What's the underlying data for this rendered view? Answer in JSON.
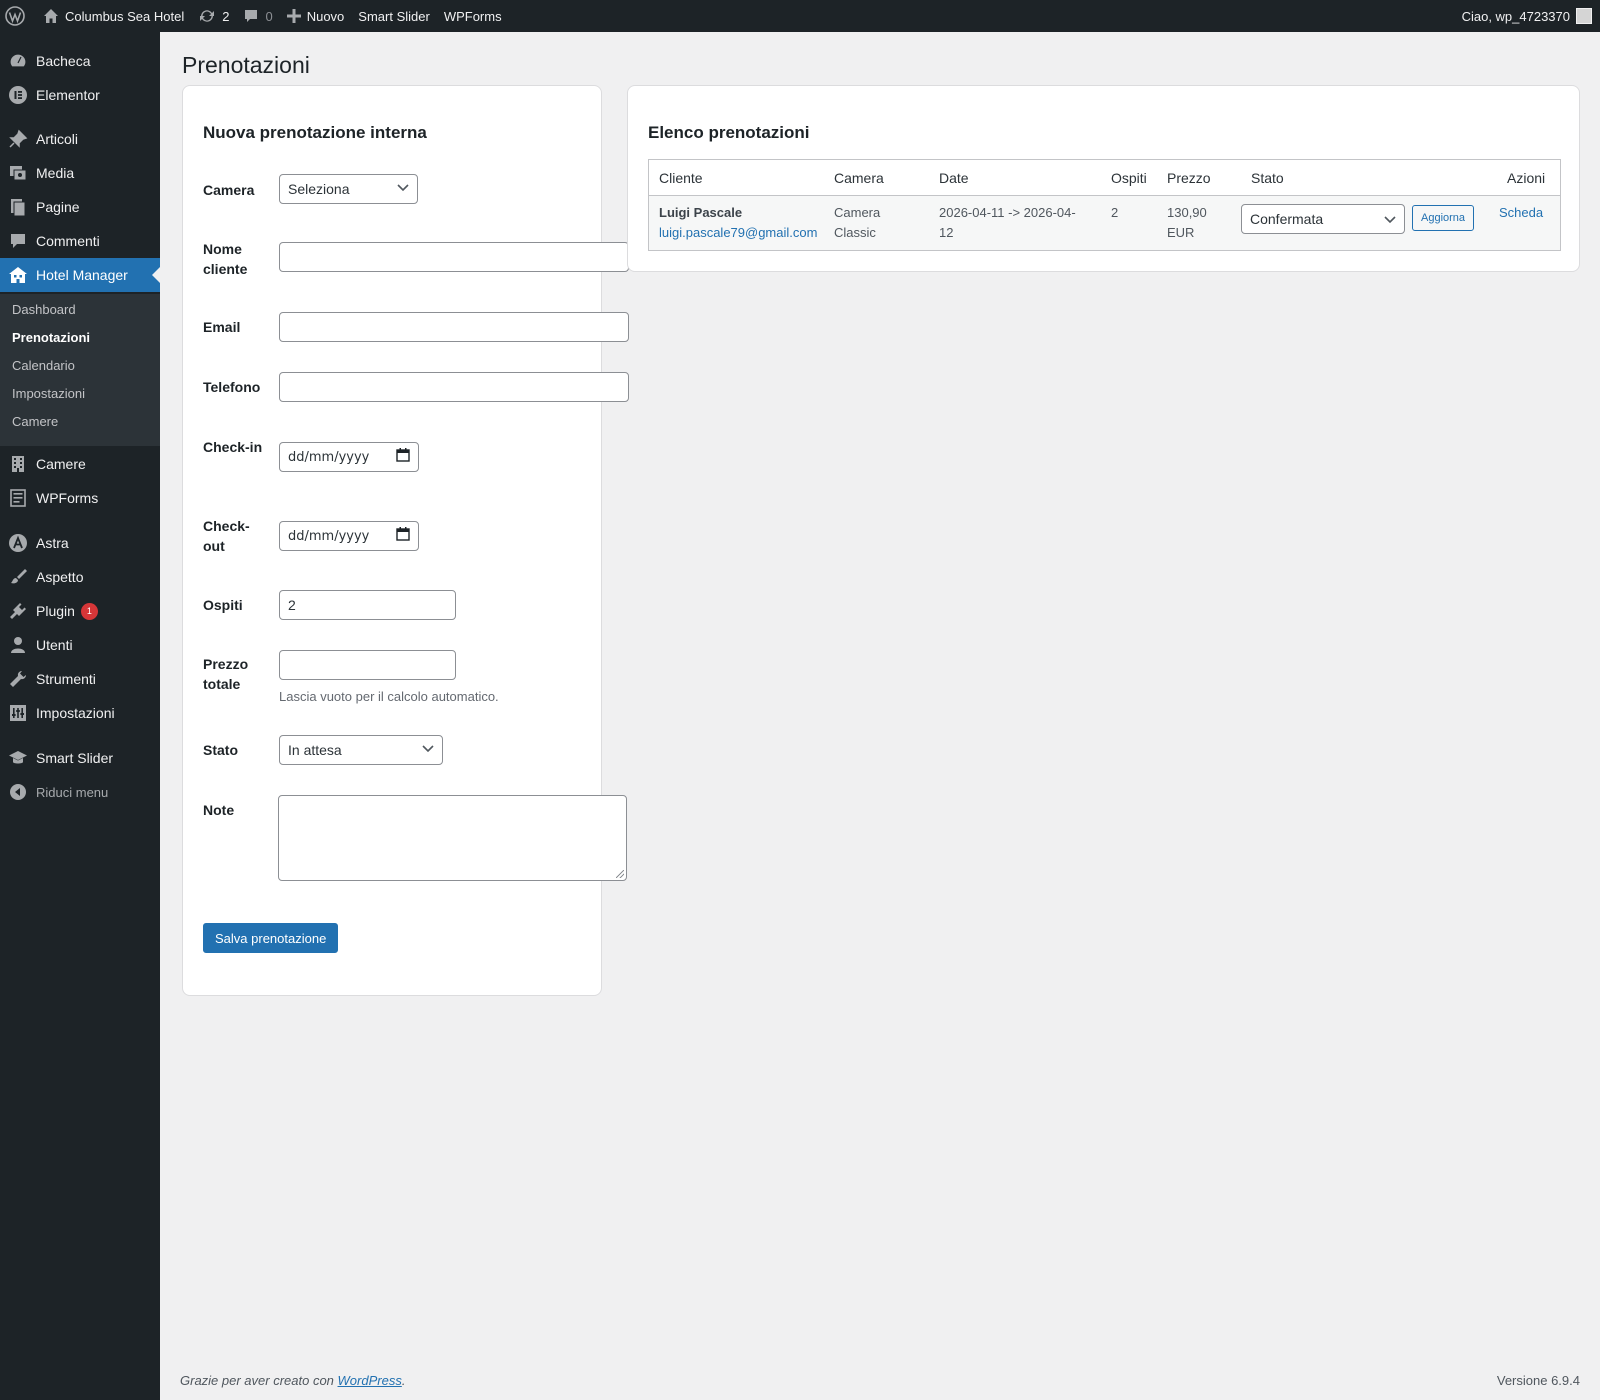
{
  "adminbar": {
    "site_name": "Columbus Sea Hotel",
    "updates_count": "2",
    "comments_count": "0",
    "new_label": "Nuovo",
    "smart_slider": "Smart Slider",
    "wpforms": "WPForms",
    "greeting": "Ciao, wp_4723370"
  },
  "sidebar": {
    "items": [
      {
        "label": "Bacheca",
        "icon": "dashboard-icon"
      },
      {
        "label": "Elementor",
        "icon": "elementor-icon"
      },
      {
        "label": "Articoli",
        "icon": "pin-icon"
      },
      {
        "label": "Media",
        "icon": "media-icon"
      },
      {
        "label": "Pagine",
        "icon": "pages-icon"
      },
      {
        "label": "Commenti",
        "icon": "comment-icon"
      },
      {
        "label": "Hotel Manager",
        "icon": "building-icon"
      },
      {
        "label": "Camere",
        "icon": "building-icon"
      },
      {
        "label": "WPForms",
        "icon": "form-icon"
      },
      {
        "label": "Astra",
        "icon": "astra-icon"
      },
      {
        "label": "Aspetto",
        "icon": "brush-icon"
      },
      {
        "label": "Plugin",
        "icon": "plugin-icon",
        "badge": "1"
      },
      {
        "label": "Utenti",
        "icon": "user-icon"
      },
      {
        "label": "Strumenti",
        "icon": "wrench-icon"
      },
      {
        "label": "Impostazioni",
        "icon": "settings-icon"
      },
      {
        "label": "Smart Slider",
        "icon": "graduation-icon"
      }
    ],
    "submenu": [
      "Dashboard",
      "Prenotazioni",
      "Calendario",
      "Impostazioni",
      "Camere"
    ],
    "collapse_label": "Riduci menu"
  },
  "page": {
    "title": "Prenotazioni"
  },
  "form": {
    "title": "Nuova prenotazione interna",
    "camera_label": "Camera",
    "camera_value": "Seleziona",
    "nome_label": "Nome cliente",
    "nome_value": "",
    "email_label": "Email",
    "email_value": "",
    "telefono_label": "Telefono",
    "telefono_value": "",
    "checkin_label": "Check-in",
    "checkin_value": "dd/mm/yyyy",
    "checkout_label": "Check-out",
    "checkout_value": "dd/mm/yyyy",
    "ospiti_label": "Ospiti",
    "ospiti_value": "2",
    "prezzo_label": "Prezzo totale",
    "prezzo_value": "",
    "prezzo_help": "Lascia vuoto per il calcolo automatico.",
    "stato_label": "Stato",
    "stato_value": "In attesa",
    "note_label": "Note",
    "note_value": "",
    "submit_label": "Salva prenotazione"
  },
  "list": {
    "title": "Elenco prenotazioni",
    "columns": [
      "Cliente",
      "Camera",
      "Date",
      "Ospiti",
      "Prezzo",
      "Stato",
      "Azioni"
    ],
    "rows": [
      {
        "client_name": "Luigi Pascale",
        "client_email": "luigi.pascale79@gmail.com",
        "camera_line1": "Camera",
        "camera_line2": "Classic",
        "dates_line1": "2026-04-11 -> 2026-04-",
        "dates_line2": "12",
        "ospiti": "2",
        "prezzo_line1": "130,90",
        "prezzo_line2": "EUR",
        "stato": "Confermata",
        "update_label": "Aggiorna",
        "action_label": "Scheda"
      }
    ]
  },
  "footer": {
    "thanks": "Grazie per aver creato con",
    "wp_link": "WordPress",
    "period": ".",
    "version": "Versione 6.9.4"
  },
  "colors": {
    "accent": "#2271b1",
    "sidebar_bg": "#1d2327",
    "submenu_bg": "#2c3338",
    "badge": "#d63638"
  }
}
